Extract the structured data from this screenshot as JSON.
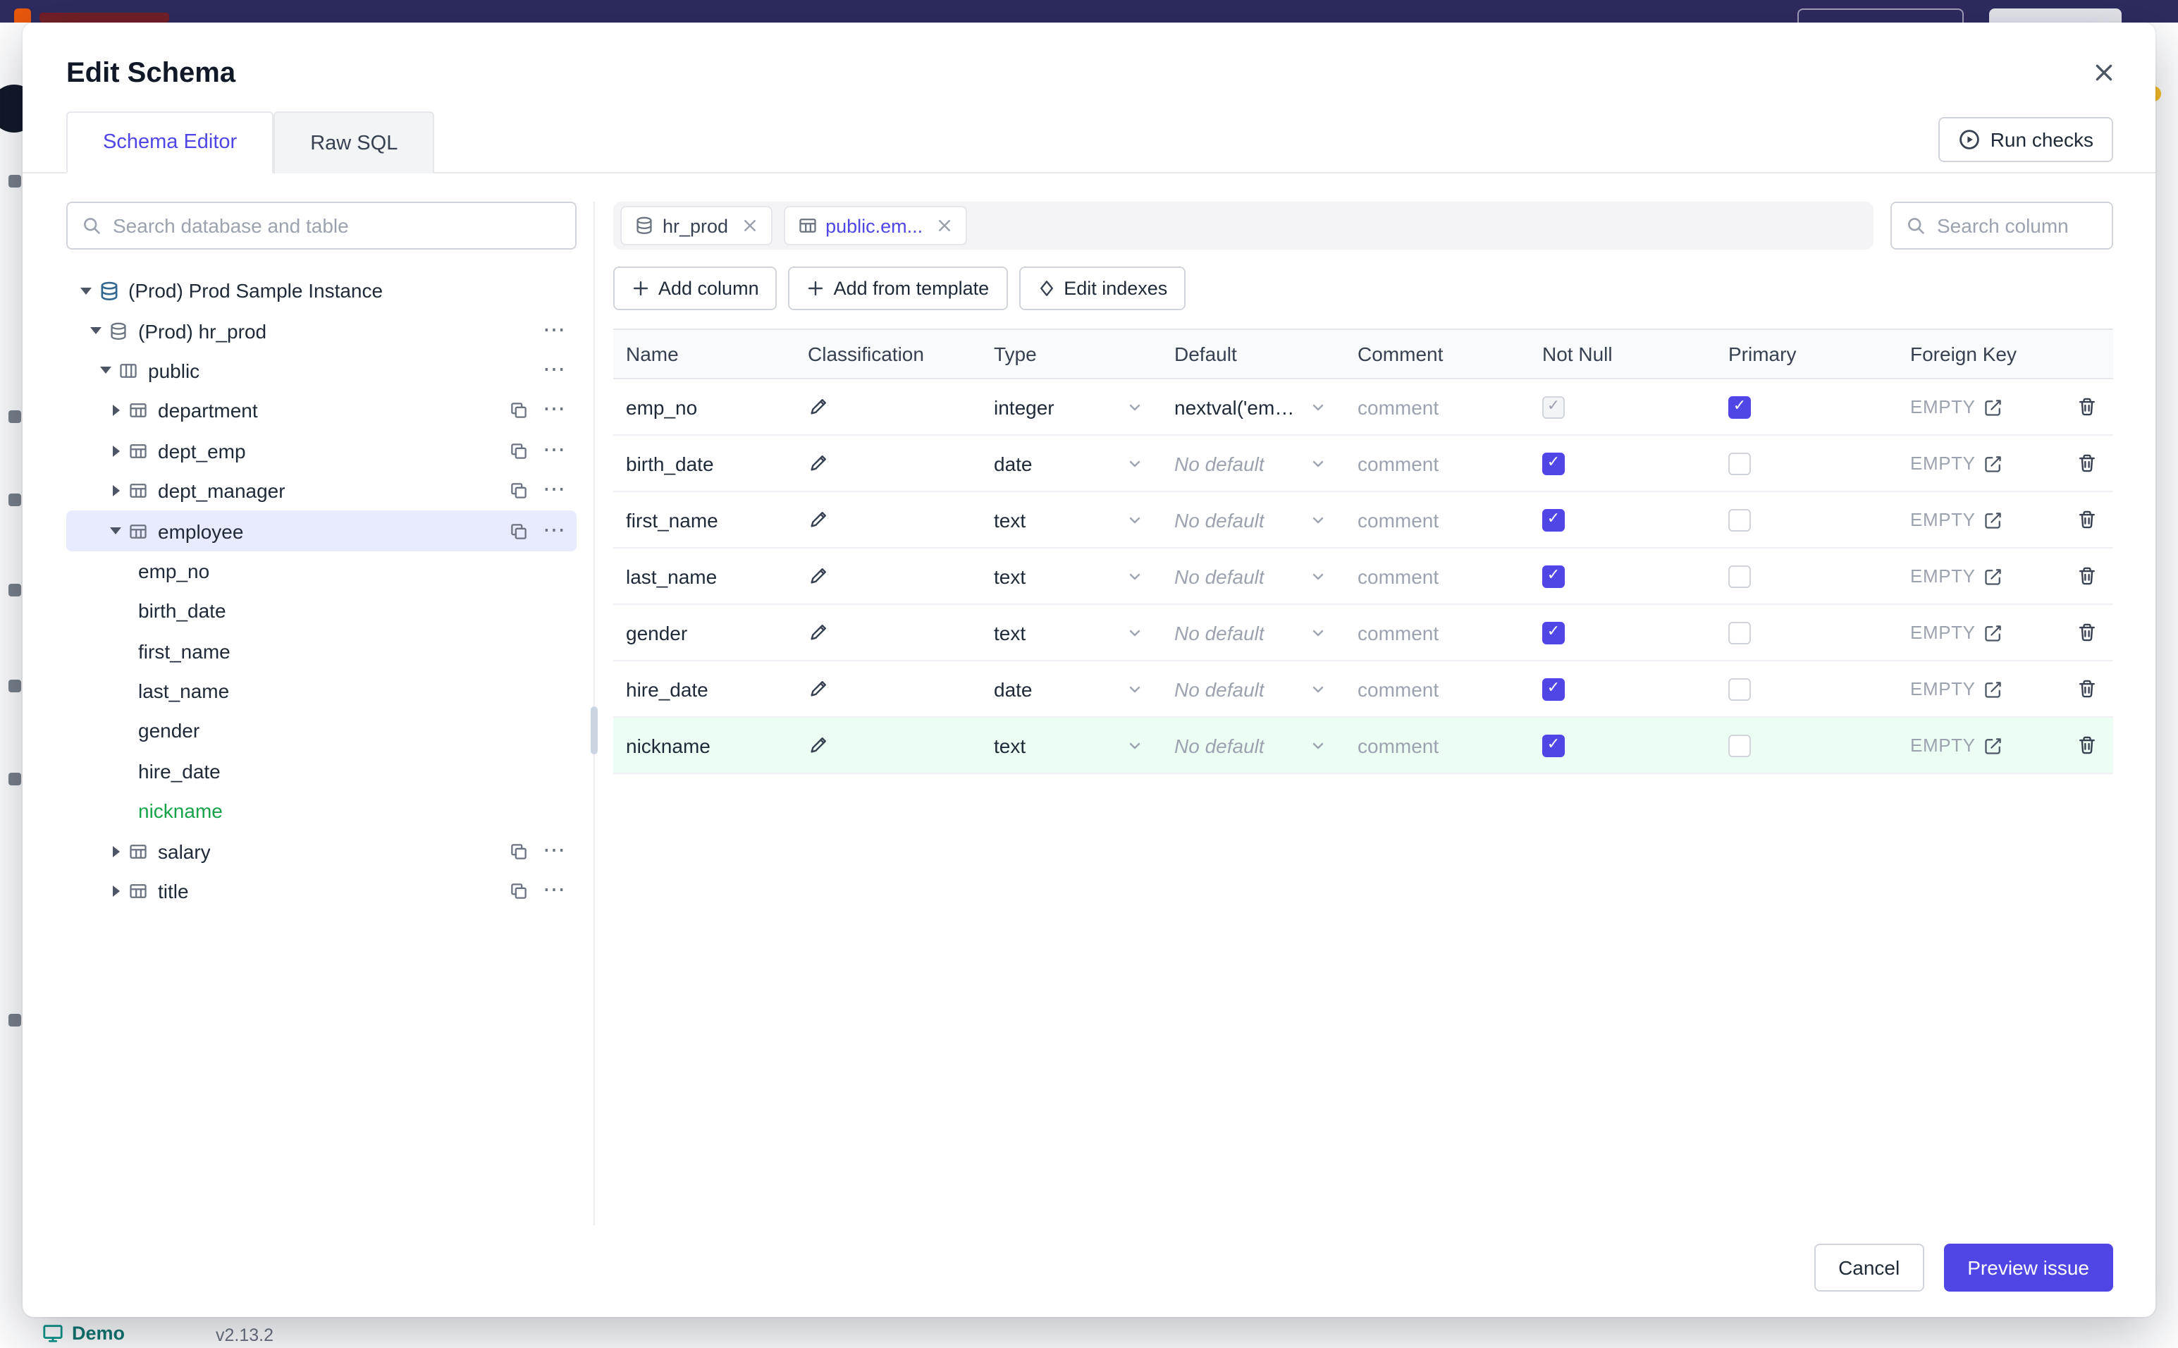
{
  "background": {
    "demo_label": "Demo",
    "version": "v2.13.2"
  },
  "modal": {
    "title": "Edit Schema",
    "run_checks_label": "Run checks",
    "tabs": [
      {
        "label": "Schema Editor",
        "active": true
      },
      {
        "label": "Raw SQL",
        "active": false
      }
    ]
  },
  "left_panel": {
    "search_placeholder": "Search database and table",
    "tree": [
      {
        "label": "(Prod) Prod Sample Instance",
        "level": 0,
        "caret": "down",
        "icon": "instance"
      },
      {
        "label": "(Prod) hr_prod",
        "level": 1,
        "caret": "down",
        "icon": "database",
        "more": true
      },
      {
        "label": "public",
        "level": 2,
        "caret": "down",
        "icon": "schema",
        "more": true
      },
      {
        "label": "department",
        "level": 3,
        "caret": "right",
        "icon": "table",
        "copy": true,
        "more": true
      },
      {
        "label": "dept_emp",
        "level": 3,
        "caret": "right",
        "icon": "table",
        "copy": true,
        "more": true
      },
      {
        "label": "dept_manager",
        "level": 3,
        "caret": "right",
        "icon": "table",
        "copy": true,
        "more": true
      },
      {
        "label": "employee",
        "level": 3,
        "caret": "down",
        "icon": "table",
        "copy": true,
        "more": true,
        "selected": true
      },
      {
        "label": "emp_no",
        "level": 3,
        "leaf": true
      },
      {
        "label": "birth_date",
        "level": 3,
        "leaf": true
      },
      {
        "label": "first_name",
        "level": 3,
        "leaf": true
      },
      {
        "label": "last_name",
        "level": 3,
        "leaf": true
      },
      {
        "label": "gender",
        "level": 3,
        "leaf": true
      },
      {
        "label": "hire_date",
        "level": 3,
        "leaf": true
      },
      {
        "label": "nickname",
        "level": 3,
        "leaf": true,
        "green": true
      },
      {
        "label": "salary",
        "level": 3,
        "caret": "right",
        "icon": "table",
        "copy": true,
        "more": true
      },
      {
        "label": "title",
        "level": 3,
        "caret": "right",
        "icon": "table",
        "copy": true,
        "more": true
      }
    ]
  },
  "editor": {
    "chips": [
      {
        "label": "hr_prod",
        "icon": "database",
        "active": false
      },
      {
        "label": "public.em...",
        "icon": "table",
        "active": true
      }
    ],
    "search_column_placeholder": "Search column",
    "actions": {
      "add_column": "Add column",
      "add_from_template": "Add from template",
      "edit_indexes": "Edit indexes"
    },
    "table": {
      "columns": [
        "Name",
        "Classification",
        "Type",
        "Default",
        "Comment",
        "Not Null",
        "Primary",
        "Foreign Key"
      ],
      "comment_placeholder": "comment",
      "rows": [
        {
          "name": "emp_no",
          "type": "integer",
          "default": "nextval('employ",
          "default_muted": false,
          "not_null": "checked-disabled",
          "primary": "checked",
          "foreign_key": "EMPTY",
          "highlight": false
        },
        {
          "name": "birth_date",
          "type": "date",
          "default": "No default",
          "default_muted": true,
          "not_null": "checked",
          "primary": "unchecked",
          "foreign_key": "EMPTY",
          "highlight": false
        },
        {
          "name": "first_name",
          "type": "text",
          "default": "No default",
          "default_muted": true,
          "not_null": "checked",
          "primary": "unchecked",
          "foreign_key": "EMPTY",
          "highlight": false
        },
        {
          "name": "last_name",
          "type": "text",
          "default": "No default",
          "default_muted": true,
          "not_null": "checked",
          "primary": "unchecked",
          "foreign_key": "EMPTY",
          "highlight": false
        },
        {
          "name": "gender",
          "type": "text",
          "default": "No default",
          "default_muted": true,
          "not_null": "checked",
          "primary": "unchecked",
          "foreign_key": "EMPTY",
          "highlight": false
        },
        {
          "name": "hire_date",
          "type": "date",
          "default": "No default",
          "default_muted": true,
          "not_null": "checked",
          "primary": "unchecked",
          "foreign_key": "EMPTY",
          "highlight": false
        },
        {
          "name": "nickname",
          "type": "text",
          "default": "No default",
          "default_muted": true,
          "not_null": "checked",
          "primary": "unchecked",
          "foreign_key": "EMPTY",
          "highlight": true
        }
      ]
    },
    "footer": {
      "cancel_label": "Cancel",
      "primary_label": "Preview issue"
    }
  }
}
